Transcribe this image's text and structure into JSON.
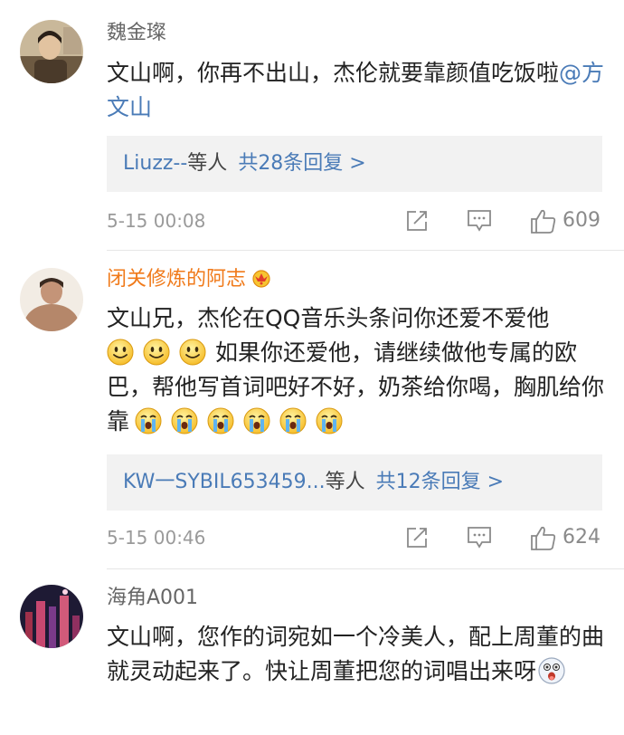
{
  "comments": [
    {
      "username": "魏金璨",
      "text": "文山啊，你再不出山，杰伦就要靠颜值吃饭啦",
      "mention": "@方文山",
      "reply_preview": {
        "users": "Liuzz--",
        "suffix": "等人",
        "count_label": "共28条回复 >"
      },
      "timestamp": "5-15 00:08",
      "likes": "609",
      "avatar_color": "#7a6a52"
    },
    {
      "username": "闭关修炼的阿志",
      "username_color": "#f07a1a",
      "badge": "vip-crown-icon",
      "text_part1": "文山兄，杰伦在QQ音乐头条问你还爱不爱他",
      "text_part2": "如果你还爱他，请继续做他专属的欧巴，帮他写首词吧好不好，奶茶给你喝，胸肌给你靠",
      "reply_preview": {
        "users": "KW一SYBIL653459...",
        "suffix": "等人",
        "count_label": "共12条回复 >"
      },
      "timestamp": "5-15 00:46",
      "likes": "624",
      "avatar_color": "#a07a62"
    },
    {
      "username": "海角A001",
      "text": "文山啊，您作的词宛如一个冷美人，配上周董的曲就灵动起来了。快让周董把您的词唱出来呀",
      "avatar_color": "#5a2a4a"
    }
  ],
  "icons": {
    "share": "share-icon",
    "comment": "comment-icon",
    "like": "thumbs-up-icon",
    "smile": "smile-emoji-icon",
    "cry": "crying-emoji-icon",
    "surprised": "surprised-emoji-icon"
  },
  "colors": {
    "link": "#4a7bb7",
    "vip_name": "#f07a1a",
    "reply_bg": "#f2f2f2"
  }
}
